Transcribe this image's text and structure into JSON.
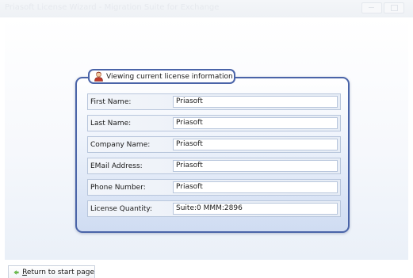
{
  "window": {
    "title": "Priasoft License Wizard - Migration Suite for Exchange"
  },
  "panel": {
    "legend": "Viewing current license information",
    "icon": "user-license-icon",
    "fields": [
      {
        "label": "First Name:",
        "value": "Priasoft"
      },
      {
        "label": "Last Name:",
        "value": "Priasoft"
      },
      {
        "label": "Company Name:",
        "value": "Priasoft"
      },
      {
        "label": "EMail Address:",
        "value": "Priasoft"
      },
      {
        "label": "Phone Number:",
        "value": "Priasoft"
      },
      {
        "label": "License Quantity:",
        "value": "Suite:0  MMM:2896"
      }
    ]
  },
  "footer": {
    "return_mnemonic": "R",
    "return_rest": "eturn to start page",
    "return_icon": "arrow-left-icon"
  },
  "colors": {
    "panel_border": "#4a64a8",
    "panel_gradient_bottom": "#cfdcf2",
    "field_border": "#b8c6dc"
  }
}
